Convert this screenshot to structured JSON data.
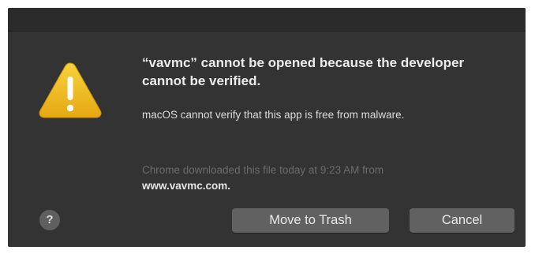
{
  "dialog": {
    "headline": "“vavmc” cannot be opened because the developer cannot be verified.",
    "detail": "macOS cannot verify that this app is free from malware.",
    "download_info": "Chrome downloaded this file today at 9:23 AM from",
    "download_source": "www.vavmc.com.",
    "help_label": "?",
    "buttons": {
      "move_to_trash": "Move to Trash",
      "cancel": "Cancel"
    }
  },
  "icons": {
    "warning": "warning-triangle-icon",
    "help": "help-icon"
  },
  "colors": {
    "dialog_background": "#333333",
    "titlebar_background": "#2b2b2b",
    "button_background": "#616161",
    "warning_yellow": "#f2c222"
  }
}
